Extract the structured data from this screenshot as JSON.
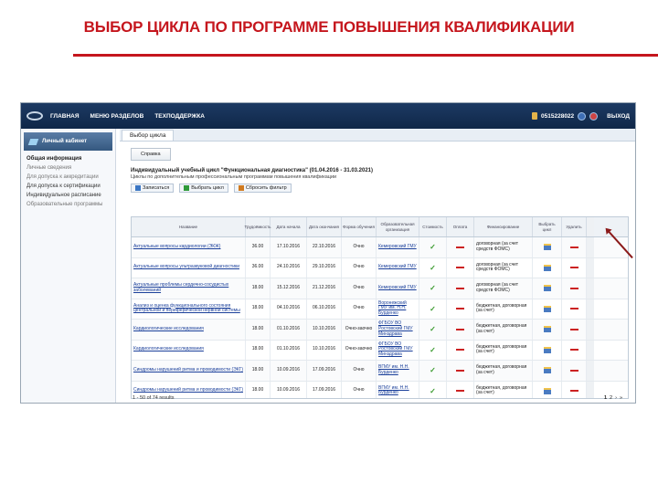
{
  "slide_title": "ВЫБОР ЦИКЛА ПО ПРОГРАММЕ ПОВЫШЕНИЯ КВАЛИФИКАЦИИ",
  "topbar": {
    "nav": [
      "ГЛАВНАЯ",
      "МЕНЮ РАЗДЕЛОВ",
      "ТЕХПОДДЕРЖКА"
    ],
    "user_id": "0515228022",
    "exit_label": "ВЫХОД"
  },
  "sidebar": {
    "header": "Личный кабинет",
    "items": [
      "Общая информация",
      "Личные сведения",
      "Для допуска к аккредитации",
      "Для допуска к сертификации",
      "Индивидуальное расписание",
      "Образовательные программы"
    ]
  },
  "main": {
    "tab": "Выбор цикла",
    "help_button": "Справка",
    "cycle_title": "Индивидуальный учебный цикл \"Функциональная диагностика\" (01.04.2016 - 31.03.2021)",
    "cycle_subtitle": "Циклы по дополнительным профессиональным программам повышения квалификации",
    "toolbar": [
      "Записаться",
      "Выбрать цикл",
      "Сбросить фильтр"
    ]
  },
  "grid": {
    "headers": [
      "Название",
      "Трудоёмкость",
      "Дата начала",
      "Дата окончания",
      "Форма обучения",
      "Образовательная организация",
      "Стоимость",
      "Оплата",
      "Финансирование",
      "Выбрать цикл",
      "Удалить"
    ],
    "rows": [
      {
        "name": "Актуальные вопросы кардиологии (ЭКЖ)",
        "hours": "36.00",
        "start": "17.10.2016",
        "end": "22.10.2016",
        "form": "Очно",
        "place": "Кемеровский ГМУ",
        "fin": "договорная (за счет средств ФОМС)"
      },
      {
        "name": "Актуальные вопросы ультразвуковой диагностики",
        "hours": "36.00",
        "start": "24.10.2016",
        "end": "29.10.2016",
        "form": "Очно",
        "place": "Кемеровский ГМУ",
        "fin": "договорная (за счет средств ФОМС)"
      },
      {
        "name": "Актуальные проблемы сердечно-сосудистых заболеваний",
        "hours": "18.00",
        "start": "15.12.2016",
        "end": "21.12.2016",
        "form": "Очно",
        "place": "Кемеровский ГМУ",
        "fin": "договорная (за счет средств ФОМС)"
      },
      {
        "name": "Анализ и оценка функционального состояния центральной и периферической нервной системы",
        "hours": "18.00",
        "start": "04.10.2016",
        "end": "06.10.2016",
        "form": "Очно",
        "place": "Воронежский ГМУ им. Н.Н. Бурденко",
        "fin": "бюджетная, договорная (за счет)"
      },
      {
        "name": "Кардиологические исследования",
        "hours": "18.00",
        "start": "01.10.2016",
        "end": "10.10.2016",
        "form": "Очно-заочно",
        "place": "ФГБОУ ВО Ростовский ГМУ Минздрава",
        "fin": "бюджетная, договорная (за счет)"
      },
      {
        "name": "Кардиологические исследования",
        "hours": "18.00",
        "start": "01.10.2016",
        "end": "10.10.2016",
        "form": "Очно-заочно",
        "place": "ФГБОУ ВО Ростовский ГМУ Минздрава",
        "fin": "бюджетная, договорная (за счет)"
      },
      {
        "name": "Синдромы нарушений ритма и проводимости (ЭКГ)",
        "hours": "18.00",
        "start": "10.09.2016",
        "end": "17.09.2016",
        "form": "Очно",
        "place": "ВГМУ им. Н.Н. Бурденко",
        "fin": "бюджетная, договорная (за счет)"
      },
      {
        "name": "Синдромы нарушений ритма и проводимости (ЭКГ)",
        "hours": "18.00",
        "start": "10.09.2016",
        "end": "17.09.2016",
        "form": "Очно",
        "place": "ВГМУ им. Н.Н. Бурденко",
        "fin": "бюджетная, договорная (за счет)"
      }
    ],
    "footer_count": "1 - 50 of 74 results",
    "pages": [
      "1",
      "2",
      "›",
      "»"
    ]
  }
}
